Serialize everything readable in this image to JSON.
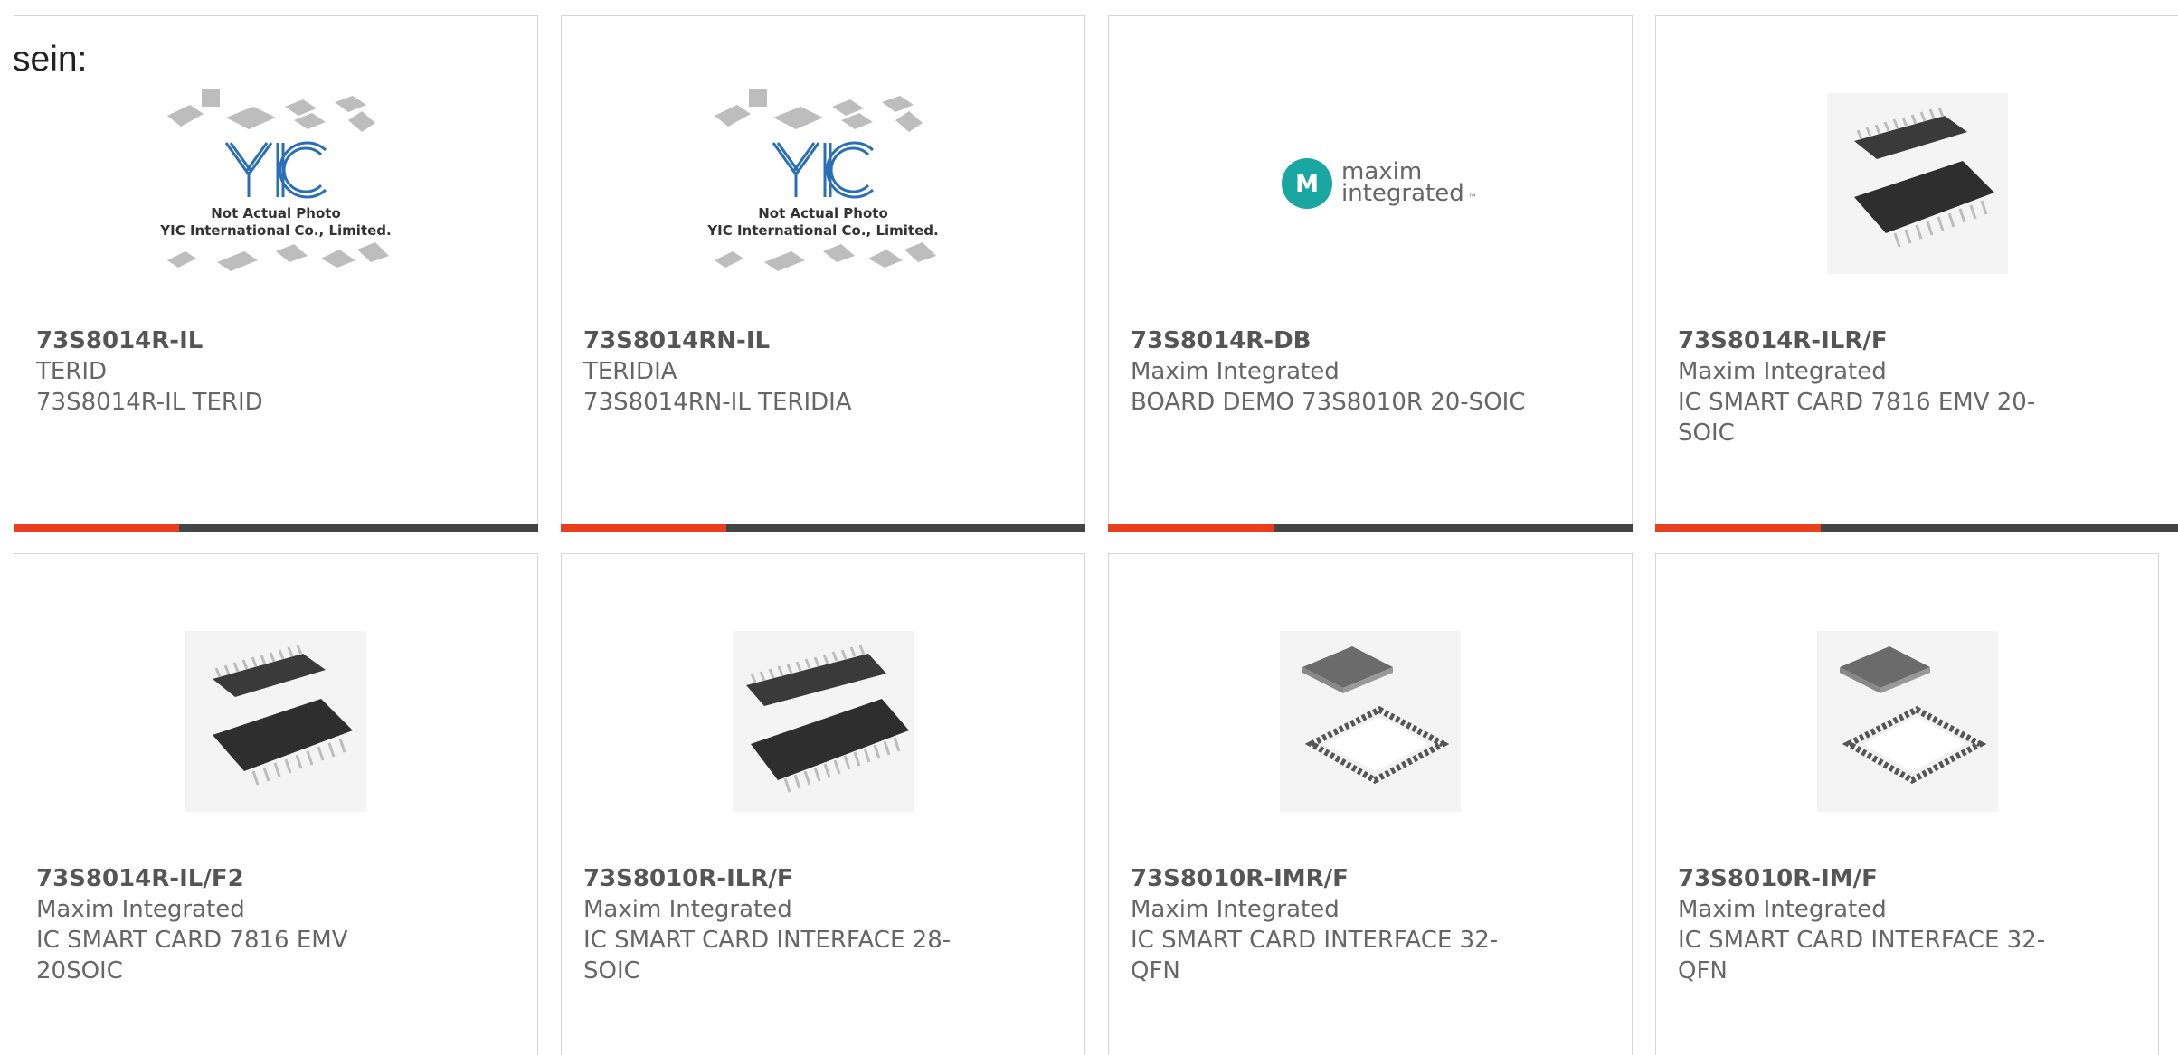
{
  "intro_text": "sein:",
  "brand_colors": {
    "accent": "#e8401c",
    "bar": "#444444",
    "maxim_teal": "#1aa7a1",
    "yic_blue": "#2a6fb5"
  },
  "placeholder_image": {
    "logo_text": "YIC",
    "caption_line1": "Not Actual Photo",
    "caption_line2": "YIC International Co., Limited."
  },
  "maxim_logo": {
    "line1": "maxim",
    "line2": "integrated",
    "tm": "™"
  },
  "products": [
    {
      "part_number": "73S8014R-IL",
      "manufacturer": "TERID",
      "description": "73S8014R-IL TERID",
      "image": "yic-placeholder-image"
    },
    {
      "part_number": "73S8014RN-IL",
      "manufacturer": "TERIDIA",
      "description": "73S8014RN-IL TERIDIA",
      "image": "yic-placeholder-image"
    },
    {
      "part_number": "73S8014R-DB",
      "manufacturer": "Maxim Integrated",
      "description": "BOARD DEMO 73S8010R 20-SOIC",
      "image": "maxim-logo-image"
    },
    {
      "part_number": "73S8014R-ILR/F",
      "manufacturer": "Maxim Integrated",
      "description": "IC SMART CARD 7816 EMV 20-SOIC",
      "image": "soic-20-chip-image"
    },
    {
      "part_number": "73S8014R-IL/F2",
      "manufacturer": "Maxim Integrated",
      "description": "IC SMART CARD 7816 EMV 20SOIC",
      "image": "soic-20-chip-image"
    },
    {
      "part_number": "73S8010R-ILR/F",
      "manufacturer": "Maxim Integrated",
      "description": "IC SMART CARD INTERFACE 28-SOIC",
      "image": "soic-28-chip-image"
    },
    {
      "part_number": "73S8010R-IMR/F",
      "manufacturer": "Maxim Integrated",
      "description": "IC SMART CARD INTERFACE 32-QFN",
      "image": "qfn-32-chip-image"
    },
    {
      "part_number": "73S8010R-IM/F",
      "manufacturer": "Maxim Integrated",
      "description": "IC SMART CARD INTERFACE 32-QFN",
      "image": "qfn-32-chip-image"
    }
  ]
}
